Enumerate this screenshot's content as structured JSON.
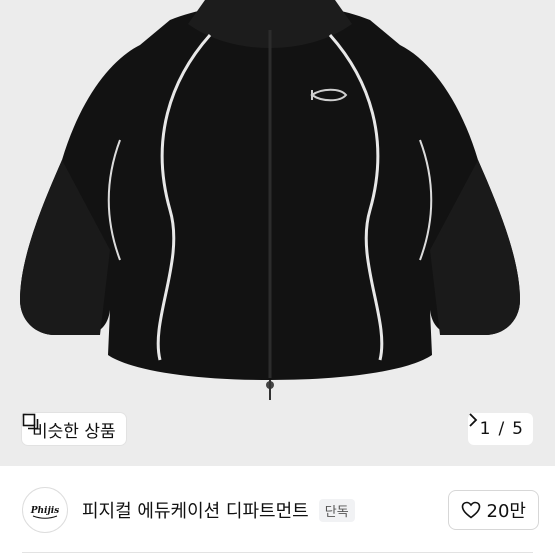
{
  "gallery": {
    "similar_label": "비슷한 상품",
    "pager": {
      "current": "1",
      "separator": "/",
      "total": "5"
    }
  },
  "store": {
    "logo_text": "Phijis",
    "name": "피지컬 에듀케이션 디파트먼트",
    "badge": "단독",
    "likes": "20만"
  },
  "icons": {
    "similar": "copy-icon",
    "pager_next": "chevron-right-icon",
    "like": "heart-outline-icon"
  }
}
